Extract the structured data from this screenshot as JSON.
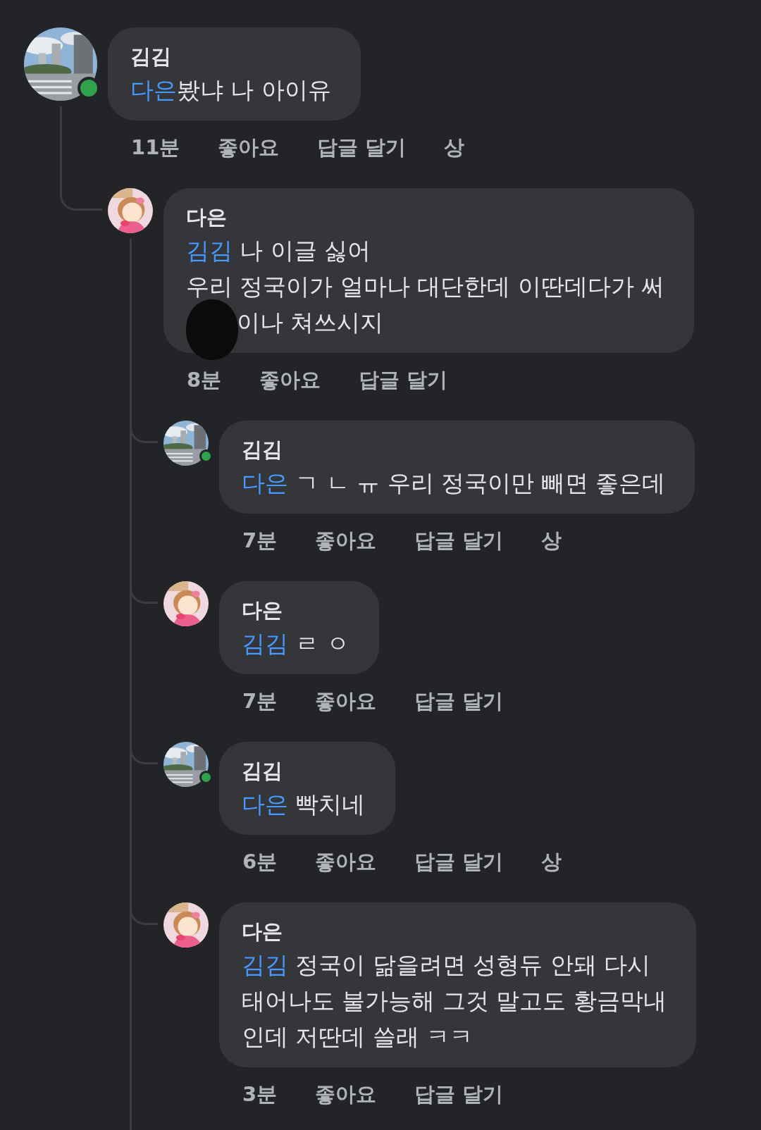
{
  "comments": [
    {
      "author": "김김",
      "photo_avatar": true,
      "online": true,
      "mention": "다은",
      "lines": [
        {
          "text": "봤냐 나 아이유",
          "redacted": false
        }
      ],
      "time": "11분",
      "actions": [
        "좋아요",
        "답글 달기",
        "상"
      ],
      "children": [
        {
          "author": "다은",
          "photo_avatar": false,
          "online": false,
          "mention": "김김",
          "lines": [
            {
              "text": " 나 이글 싫어",
              "redacted": false
            },
            {
              "text": "우리 정국이가 얼마나 대단한데 이딴데다가 써",
              "redacted": false
            },
            {
              "text": "이나 쳐쓰시지",
              "redacted": true
            }
          ],
          "time": "8분",
          "actions": [
            "좋아요",
            "답글 달기"
          ],
          "more_replies": true,
          "children": [
            {
              "author": "김김",
              "photo_avatar": true,
              "online": true,
              "mention": "다은",
              "lines": [
                {
                  "text": " ㄱ ㄴ ㅠ 우리 정국이만 빼면 좋은데",
                  "redacted": false
                }
              ],
              "time": "7분",
              "actions": [
                "좋아요",
                "답글 달기",
                "상"
              ]
            },
            {
              "author": "다은",
              "photo_avatar": false,
              "online": false,
              "mention": "김김",
              "lines": [
                {
                  "text": " ㄹ ㅇ",
                  "redacted": false
                }
              ],
              "time": "7분",
              "actions": [
                "좋아요",
                "답글 달기"
              ]
            },
            {
              "author": "김김",
              "photo_avatar": true,
              "online": true,
              "mention": "다은",
              "lines": [
                {
                  "text": " 빡치네",
                  "redacted": false
                }
              ],
              "time": "6분",
              "actions": [
                "좋아요",
                "답글 달기",
                "상"
              ]
            },
            {
              "author": "다은",
              "photo_avatar": false,
              "online": false,
              "mention": "김김",
              "lines": [
                {
                  "text": " 정국이 닮을려면 성형듀 안돼 다시",
                  "redacted": false
                },
                {
                  "text": "태어나도 불가능해 그것 말고도 황금막내",
                  "redacted": false
                },
                {
                  "text": "인데 저딴데 쓸래 ㅋㅋ",
                  "redacted": false
                }
              ],
              "time": "3분",
              "actions": [
                "좋아요",
                "답글 달기"
              ]
            }
          ]
        }
      ]
    }
  ]
}
